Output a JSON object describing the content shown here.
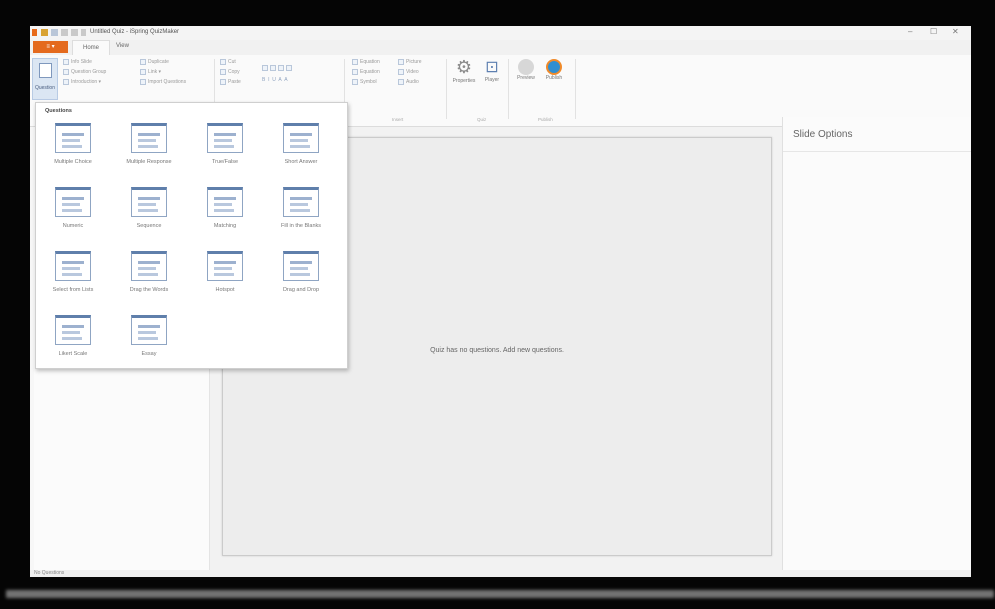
{
  "window": {
    "title": "Untitled Quiz - iSpring QuizMaker",
    "controls": [
      "–",
      "☐",
      "✕"
    ]
  },
  "tabs": {
    "file": "≡ ▾",
    "home": "Home",
    "view": "View"
  },
  "ribbon": {
    "question_button": "Question",
    "small_buttons": [
      "Info Slide",
      "Question Group",
      "Introduction ▾",
      "Duplicate",
      "Link ▾",
      "Import Questions"
    ],
    "clipboard": [
      "Cut",
      "Copy",
      "Paste"
    ],
    "insert_items": [
      "Equation",
      "Picture",
      "Equation",
      "Video",
      "Symbol",
      "Audio"
    ],
    "quiz_buttons": [
      "Properties",
      "Player"
    ],
    "publish_buttons": [
      "Preview",
      "Publish"
    ],
    "group_labels": [
      "Insert",
      "Quiz",
      "Publish"
    ]
  },
  "questions_menu": {
    "title": "Questions",
    "items": [
      {
        "label": "Multiple Choice"
      },
      {
        "label": "Multiple Response"
      },
      {
        "label": "True/False"
      },
      {
        "label": "Short Answer"
      },
      {
        "label": "Numeric"
      },
      {
        "label": "Sequence"
      },
      {
        "label": "Matching"
      },
      {
        "label": "Fill in the Blanks"
      },
      {
        "label": "Select from Lists"
      },
      {
        "label": "Drag the Words"
      },
      {
        "label": "Hotspot"
      },
      {
        "label": "Drag and Drop"
      },
      {
        "label": "Likert Scale"
      },
      {
        "label": "Essay"
      }
    ]
  },
  "slide": {
    "empty_message": "Quiz has no questions. Add new questions."
  },
  "right_panel": {
    "title": "Slide Options"
  },
  "status": {
    "text": "No Questions"
  },
  "colors": {
    "accent": "#e46a1e",
    "frame": "#000000"
  }
}
